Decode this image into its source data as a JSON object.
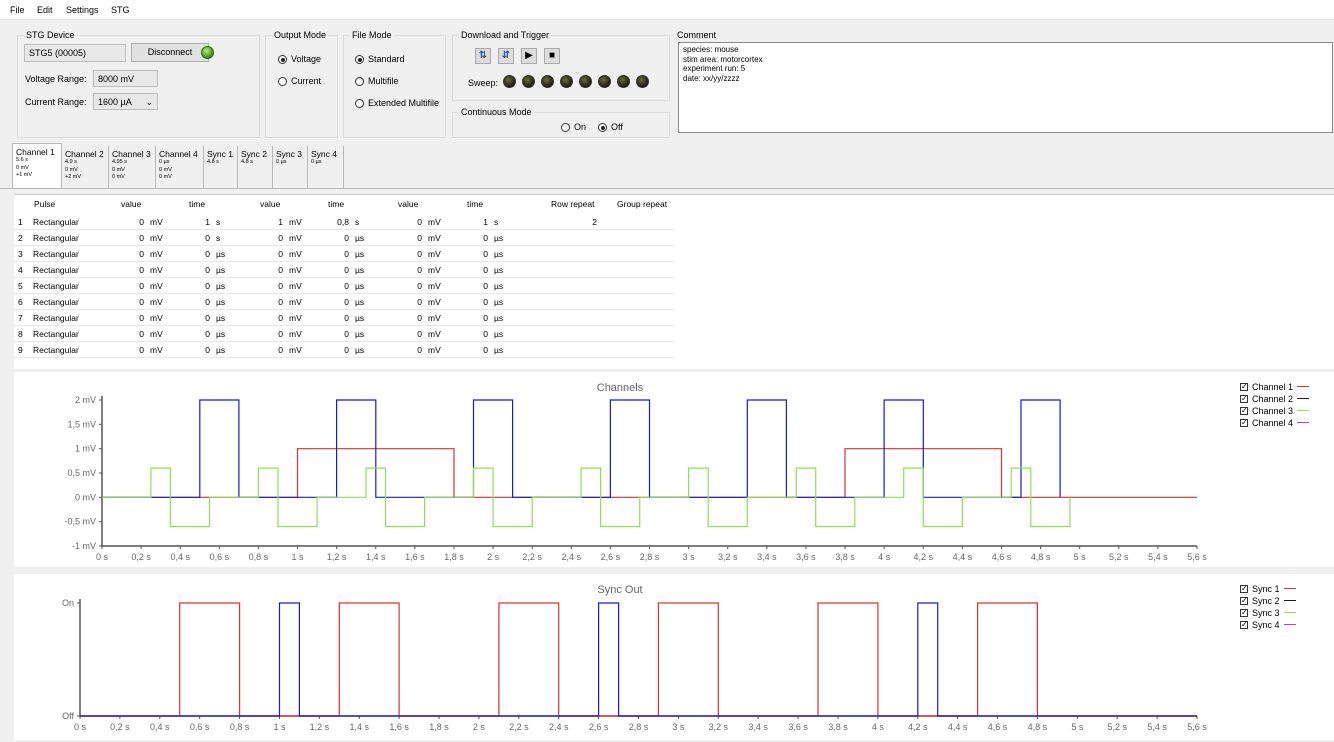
{
  "menu": [
    "File",
    "Edit",
    "Settings",
    "STG"
  ],
  "stg_device": {
    "title": "STG Device",
    "device": "STG5 (00005)",
    "disconnect_label": "Disconnect",
    "voltage_range_label": "Voltage Range:",
    "voltage_range_value": "8000 mV",
    "current_range_label": "Current Range:",
    "current_range_value": "1600 µA"
  },
  "output_mode": {
    "title": "Output Mode",
    "voltage": "Voltage",
    "current": "Current",
    "selected": "Voltage"
  },
  "file_mode": {
    "title": "File Mode",
    "standard": "Standard",
    "multifile": "Multifile",
    "extended": "Extended Multifile",
    "selected": "Standard"
  },
  "download": {
    "title": "Download and Trigger",
    "sweep_label": "Sweep:",
    "sweep_count": 8
  },
  "continuous": {
    "title": "Continuous Mode",
    "on": "On",
    "off": "Off",
    "selected": "Off"
  },
  "comment": {
    "title": "Comment",
    "lines": [
      "species: mouse",
      "stim area: motorcortex",
      "experiment run: 5",
      "date: xx/yy/zzzz"
    ]
  },
  "tabs": [
    {
      "title": "Channel 1",
      "lines": [
        "5.6 s",
        "0 mV",
        "+1 mV"
      ]
    },
    {
      "title": "Channel 2",
      "lines": [
        "4.9 s",
        "0 mV",
        "+2 mV"
      ]
    },
    {
      "title": "Channel 3",
      "lines": [
        "4.95 s",
        "0 mV",
        "0 mV"
      ]
    },
    {
      "title": "Channel 4",
      "lines": [
        "0 µs",
        "0 mV",
        "0 mV"
      ]
    },
    {
      "title": "Sync 1",
      "lines": [
        "4.8 s"
      ]
    },
    {
      "title": "Sync 2",
      "lines": [
        "4.8 s"
      ]
    },
    {
      "title": "Sync 3",
      "lines": [
        "0 µs"
      ]
    },
    {
      "title": "Sync 4",
      "lines": [
        "0 µs"
      ]
    }
  ],
  "table": {
    "headers": [
      "Pulse",
      "value",
      "time",
      "value",
      "time",
      "value",
      "time",
      "Row repeat",
      "Group repeat"
    ],
    "rows": [
      {
        "n": "1",
        "pulse": "Rectangular",
        "v1": "0",
        "u1": "mV",
        "t1": "1",
        "tu1": "s",
        "v2": "1",
        "u2": "mV",
        "t2": "0,8",
        "tu2": "s",
        "v3": "0",
        "u3": "mV",
        "t3": "1",
        "tu3": "s",
        "rr": "2"
      },
      {
        "n": "2",
        "pulse": "Rectangular",
        "v1": "0",
        "u1": "mV",
        "t1": "0",
        "tu1": "s",
        "v2": "0",
        "u2": "mV",
        "t2": "0",
        "tu2": "µs",
        "v3": "0",
        "u3": "mV",
        "t3": "0",
        "tu3": "µs",
        "rr": ""
      },
      {
        "n": "3",
        "pulse": "Rectangular",
        "v1": "0",
        "u1": "mV",
        "t1": "0",
        "tu1": "µs",
        "v2": "0",
        "u2": "mV",
        "t2": "0",
        "tu2": "µs",
        "v3": "0",
        "u3": "mV",
        "t3": "0",
        "tu3": "µs",
        "rr": ""
      },
      {
        "n": "4",
        "pulse": "Rectangular",
        "v1": "0",
        "u1": "mV",
        "t1": "0",
        "tu1": "µs",
        "v2": "0",
        "u2": "mV",
        "t2": "0",
        "tu2": "µs",
        "v3": "0",
        "u3": "mV",
        "t3": "0",
        "tu3": "µs",
        "rr": ""
      },
      {
        "n": "5",
        "pulse": "Rectangular",
        "v1": "0",
        "u1": "mV",
        "t1": "0",
        "tu1": "µs",
        "v2": "0",
        "u2": "mV",
        "t2": "0",
        "tu2": "µs",
        "v3": "0",
        "u3": "mV",
        "t3": "0",
        "tu3": "µs",
        "rr": ""
      },
      {
        "n": "6",
        "pulse": "Rectangular",
        "v1": "0",
        "u1": "mV",
        "t1": "0",
        "tu1": "µs",
        "v2": "0",
        "u2": "mV",
        "t2": "0",
        "tu2": "µs",
        "v3": "0",
        "u3": "mV",
        "t3": "0",
        "tu3": "µs",
        "rr": ""
      },
      {
        "n": "7",
        "pulse": "Rectangular",
        "v1": "0",
        "u1": "mV",
        "t1": "0",
        "tu1": "µs",
        "v2": "0",
        "u2": "mV",
        "t2": "0",
        "tu2": "µs",
        "v3": "0",
        "u3": "mV",
        "t3": "0",
        "tu3": "µs",
        "rr": ""
      },
      {
        "n": "8",
        "pulse": "Rectangular",
        "v1": "0",
        "u1": "mV",
        "t1": "0",
        "tu1": "µs",
        "v2": "0",
        "u2": "mV",
        "t2": "0",
        "tu2": "µs",
        "v3": "0",
        "u3": "mV",
        "t3": "0",
        "tu3": "µs",
        "rr": ""
      },
      {
        "n": "9",
        "pulse": "Rectangular",
        "v1": "0",
        "u1": "mV",
        "t1": "0",
        "tu1": "µs",
        "v2": "0",
        "u2": "mV",
        "t2": "0",
        "tu2": "µs",
        "v3": "0",
        "u3": "mV",
        "t3": "0",
        "tu3": "µs",
        "rr": ""
      }
    ]
  },
  "chart_data": [
    {
      "type": "line",
      "title": "Channels",
      "xlim": [
        0,
        5.6
      ],
      "ylim": [
        -1,
        2
      ],
      "x_ticks": [
        "0 s",
        "0,2 s",
        "0,4 s",
        "0,6 s",
        "0,8 s",
        "1 s",
        "1,2 s",
        "1,4 s",
        "1,6 s",
        "1,8 s",
        "2 s",
        "2,2 s",
        "2,4 s",
        "2,6 s",
        "2,8 s",
        "3 s",
        "3,2 s",
        "3,4 s",
        "3,6 s",
        "3,8 s",
        "4 s",
        "4,2 s",
        "4,4 s",
        "4,6 s",
        "4,8 s",
        "5 s",
        "5,2 s",
        "5,4 s",
        "5,6 s"
      ],
      "y_ticks": [
        "-1 mV",
        "-0,5 mV",
        "0 mV",
        "0,5 mV",
        "1 mV",
        "1,5 mV",
        "2 mV"
      ],
      "y_tick_values": [
        -1,
        -0.5,
        0,
        0.5,
        1,
        1.5,
        2
      ],
      "legend_position": "right",
      "series": [
        {
          "name": "Channel 1",
          "color": "#e0302c",
          "points": [
            [
              0,
              0
            ],
            [
              1,
              0
            ],
            [
              1,
              1
            ],
            [
              1.8,
              1
            ],
            [
              1.8,
              0
            ],
            [
              3.8,
              0
            ],
            [
              3.8,
              1
            ],
            [
              4.6,
              1
            ],
            [
              4.6,
              0
            ],
            [
              5.6,
              0
            ]
          ]
        },
        {
          "name": "Channel 2",
          "color": "#1a1adf",
          "points": [
            [
              0,
              0
            ],
            [
              0.5,
              0
            ],
            [
              0.5,
              2
            ],
            [
              0.7,
              2
            ],
            [
              0.7,
              0
            ],
            [
              1.2,
              0
            ],
            [
              1.2,
              2
            ],
            [
              1.4,
              2
            ],
            [
              1.4,
              0
            ],
            [
              1.9,
              0
            ],
            [
              1.9,
              2
            ],
            [
              2.1,
              2
            ],
            [
              2.1,
              0
            ],
            [
              2.6,
              0
            ],
            [
              2.6,
              2
            ],
            [
              2.8,
              2
            ],
            [
              2.8,
              0
            ],
            [
              3.3,
              0
            ],
            [
              3.3,
              2
            ],
            [
              3.5,
              2
            ],
            [
              3.5,
              0
            ],
            [
              4,
              0
            ],
            [
              4,
              2
            ],
            [
              4.2,
              2
            ],
            [
              4.2,
              0
            ],
            [
              4.7,
              0
            ],
            [
              4.7,
              2
            ],
            [
              4.9,
              2
            ],
            [
              4.9,
              0
            ]
          ]
        },
        {
          "name": "Channel 3",
          "color": "#8ee34a",
          "points": [
            [
              0,
              0
            ],
            [
              0.25,
              0
            ],
            [
              0.25,
              0.6
            ],
            [
              0.35,
              0.6
            ],
            [
              0.35,
              -0.6
            ],
            [
              0.55,
              -0.6
            ],
            [
              0.55,
              0
            ],
            [
              0.8,
              0
            ],
            [
              0.8,
              0.6
            ],
            [
              0.9,
              0.6
            ],
            [
              0.9,
              -0.6
            ],
            [
              1.1,
              -0.6
            ],
            [
              1.1,
              0
            ],
            [
              1.35,
              0
            ],
            [
              1.35,
              0.6
            ],
            [
              1.45,
              0.6
            ],
            [
              1.45,
              -0.6
            ],
            [
              1.65,
              -0.6
            ],
            [
              1.65,
              0
            ],
            [
              1.9,
              0
            ],
            [
              1.9,
              0.6
            ],
            [
              2,
              0.6
            ],
            [
              2,
              -0.6
            ],
            [
              2.2,
              -0.6
            ],
            [
              2.2,
              0
            ],
            [
              2.45,
              0
            ],
            [
              2.45,
              0.6
            ],
            [
              2.55,
              0.6
            ],
            [
              2.55,
              -0.6
            ],
            [
              2.75,
              -0.6
            ],
            [
              2.75,
              0
            ],
            [
              3,
              0
            ],
            [
              3,
              0.6
            ],
            [
              3.1,
              0.6
            ],
            [
              3.1,
              -0.6
            ],
            [
              3.3,
              -0.6
            ],
            [
              3.3,
              0
            ],
            [
              3.55,
              0
            ],
            [
              3.55,
              0.6
            ],
            [
              3.65,
              0.6
            ],
            [
              3.65,
              -0.6
            ],
            [
              3.85,
              -0.6
            ],
            [
              3.85,
              0
            ],
            [
              4.1,
              0
            ],
            [
              4.1,
              0.6
            ],
            [
              4.2,
              0.6
            ],
            [
              4.2,
              -0.6
            ],
            [
              4.4,
              -0.6
            ],
            [
              4.4,
              0
            ],
            [
              4.65,
              0
            ],
            [
              4.65,
              0.6
            ],
            [
              4.75,
              0.6
            ],
            [
              4.75,
              -0.6
            ],
            [
              4.95,
              -0.6
            ],
            [
              4.95,
              0
            ]
          ]
        },
        {
          "name": "Channel 4",
          "color": "#c040c0",
          "points": []
        }
      ]
    },
    {
      "type": "line",
      "title": "Sync Out",
      "xlim": [
        0,
        5.6
      ],
      "ylim": [
        0,
        1
      ],
      "x_ticks": [
        "0 s",
        "0,2 s",
        "0,4 s",
        "0,6 s",
        "0,8 s",
        "1 s",
        "1,2 s",
        "1,4 s",
        "1,6 s",
        "1,8 s",
        "2 s",
        "2,2 s",
        "2,4 s",
        "2,6 s",
        "2,8 s",
        "3 s",
        "3,2 s",
        "3,4 s",
        "3,6 s",
        "3,8 s",
        "4 s",
        "4,2 s",
        "4,4 s",
        "4,6 s",
        "4,8 s",
        "5 s",
        "5,2 s",
        "5,4 s",
        "5,6 s"
      ],
      "y_ticks": [
        "Off",
        "On"
      ],
      "y_tick_values": [
        0,
        1
      ],
      "legend_position": "right",
      "series": [
        {
          "name": "Sync 1",
          "color": "#e0302c",
          "points": [
            [
              0,
              0
            ],
            [
              0.5,
              0
            ],
            [
              0.5,
              1
            ],
            [
              0.8,
              1
            ],
            [
              0.8,
              0
            ],
            [
              1.3,
              0
            ],
            [
              1.3,
              1
            ],
            [
              1.6,
              1
            ],
            [
              1.6,
              0
            ],
            [
              2.1,
              0
            ],
            [
              2.1,
              1
            ],
            [
              2.4,
              1
            ],
            [
              2.4,
              0
            ],
            [
              2.9,
              0
            ],
            [
              2.9,
              1
            ],
            [
              3.2,
              1
            ],
            [
              3.2,
              0
            ],
            [
              3.7,
              0
            ],
            [
              3.7,
              1
            ],
            [
              4,
              1
            ],
            [
              4,
              0
            ],
            [
              4.5,
              0
            ],
            [
              4.5,
              1
            ],
            [
              4.8,
              1
            ],
            [
              4.8,
              0
            ],
            [
              5.6,
              0
            ]
          ]
        },
        {
          "name": "Sync 2",
          "color": "#1a1adf",
          "points": [
            [
              0,
              0
            ],
            [
              1,
              0
            ],
            [
              1,
              1
            ],
            [
              1.1,
              1
            ],
            [
              1.1,
              0
            ],
            [
              2.6,
              0
            ],
            [
              2.6,
              1
            ],
            [
              2.7,
              1
            ],
            [
              2.7,
              0
            ],
            [
              4.2,
              0
            ],
            [
              4.2,
              1
            ],
            [
              4.3,
              1
            ],
            [
              4.3,
              0
            ],
            [
              5.6,
              0
            ]
          ]
        },
        {
          "name": "Sync 3",
          "color": "#8ee34a",
          "points": []
        },
        {
          "name": "Sync 4",
          "color": "#c040c0",
          "points": []
        }
      ]
    }
  ]
}
